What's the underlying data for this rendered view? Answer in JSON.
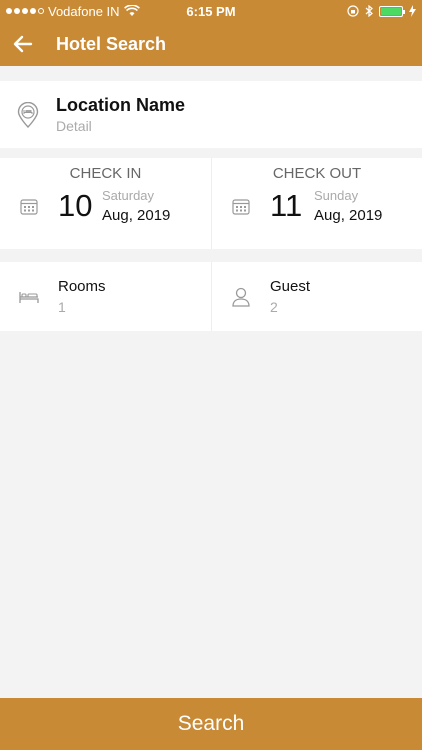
{
  "status_bar": {
    "carrier": "Vodafone IN",
    "time": "6:15 PM"
  },
  "header": {
    "title": "Hotel Search",
    "back_icon": "arrow-left-icon"
  },
  "location": {
    "name": "Location Name",
    "detail": "Detail",
    "icon": "hotel-pin-icon"
  },
  "check_in": {
    "label": "CHECK IN",
    "day": "10",
    "weekday": "Saturday",
    "month_year": "Aug, 2019"
  },
  "check_out": {
    "label": "CHECK OUT",
    "day": "11",
    "weekday": "Sunday",
    "month_year": "Aug, 2019"
  },
  "rooms": {
    "label": "Rooms",
    "value": "1"
  },
  "guest": {
    "label": "Guest",
    "value": "2"
  },
  "search_button": {
    "label": "Search"
  },
  "colors": {
    "brand": "#c98a36",
    "background": "#f3f3f3",
    "muted_text": "#aaaaaa"
  }
}
